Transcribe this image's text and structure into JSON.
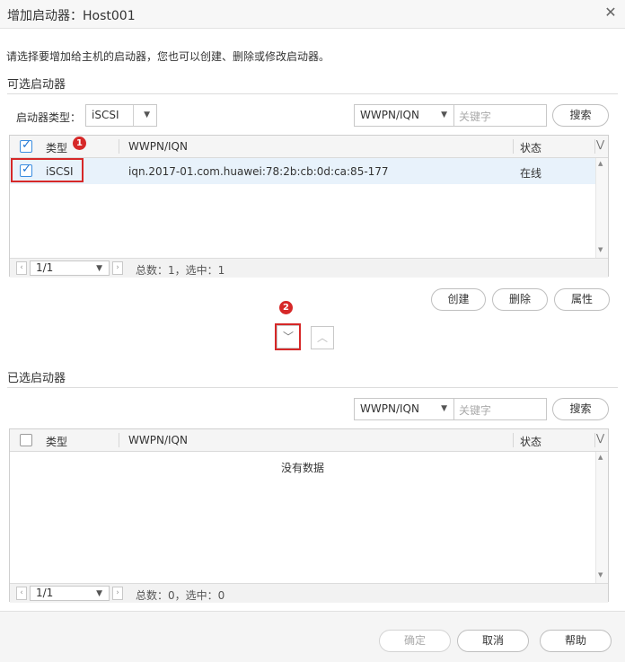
{
  "dialog": {
    "title": "增加启动器：Host001",
    "close_glyph": "✕"
  },
  "hint": "请选择要增加给主机的启动器，您也可以创建、删除或修改启动器。",
  "available": {
    "section_title": "可选启动器",
    "type_label": "启动器类型：",
    "type_value": "iSCSI",
    "filter_field": "WWPN/IQN",
    "search_placeholder": "关键字",
    "search_button": "搜索",
    "columns": [
      "类型",
      "WWPN/IQN",
      "状态"
    ],
    "rows": [
      {
        "checked": true,
        "type": "iSCSI",
        "wwpn": "iqn.2017-01.com.huawei:78:2b:cb:0d:ca:85-177",
        "status": "在线"
      }
    ],
    "page_select": "1/1",
    "summary": "总数：1，选中：1",
    "actions": {
      "create": "创建",
      "delete": "删除",
      "properties": "属性"
    }
  },
  "annotations": {
    "badge1": "1",
    "badge2": "2"
  },
  "selected": {
    "section_title": "已选启动器",
    "filter_field": "WWPN/IQN",
    "search_placeholder": "关键字",
    "search_button": "搜索",
    "columns": [
      "类型",
      "WWPN/IQN",
      "状态"
    ],
    "empty_text": "没有数据",
    "page_select": "1/1",
    "summary": "总数：0，选中：0"
  },
  "footer": {
    "ok": "确定",
    "cancel": "取消",
    "help": "帮助"
  },
  "colors": {
    "accent": "#1e73d2",
    "annotation_red": "#d62828",
    "selected_row": "#e8f2fb"
  }
}
